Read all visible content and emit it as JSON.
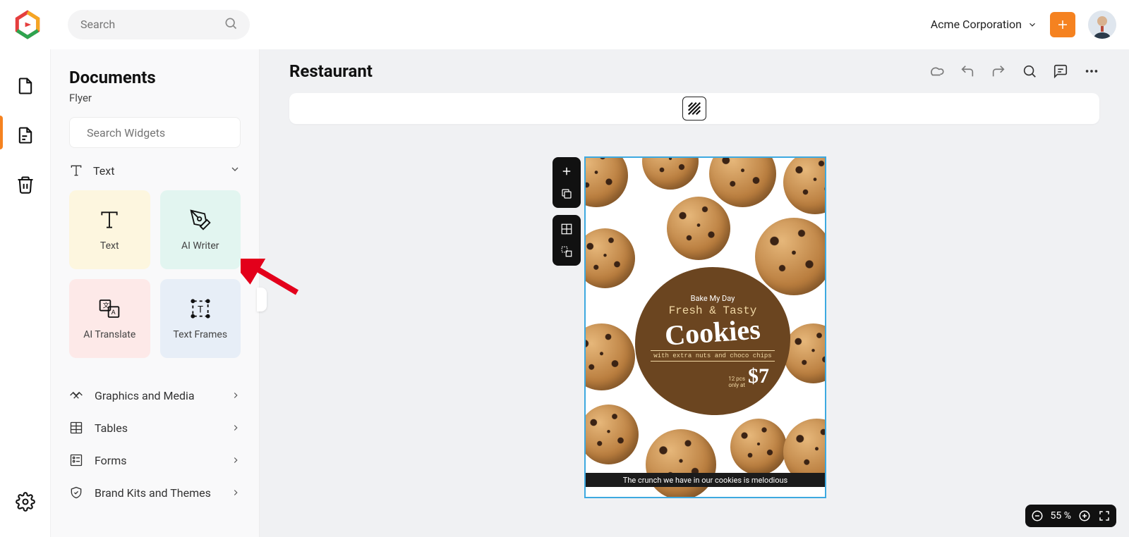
{
  "search": {
    "placeholder": "Search"
  },
  "org": {
    "name": "Acme Corporation"
  },
  "panel": {
    "title": "Documents",
    "subtitle": "Flyer",
    "widget_search_placeholder": "Search Widgets",
    "text_cat": "Text",
    "widgets": {
      "text": "Text",
      "ai_writer": "AI Writer",
      "ai_translate": "AI Translate",
      "text_frames": "Text Frames"
    },
    "cats": {
      "graphics": "Graphics and Media",
      "tables": "Tables",
      "forms": "Forms",
      "brand": "Brand Kits and Themes"
    }
  },
  "doc": {
    "title": "Restaurant"
  },
  "flyer": {
    "line1": "Bake My Day",
    "line2": "Fresh & Tasty",
    "line3": "Cookies",
    "line4": "with extra nuts and choco chips",
    "pcs": "12 pcs\nonly at",
    "price": "$7",
    "tagline": "The crunch we have in our cookies is melodious"
  },
  "zoom": {
    "value": "55 %"
  }
}
